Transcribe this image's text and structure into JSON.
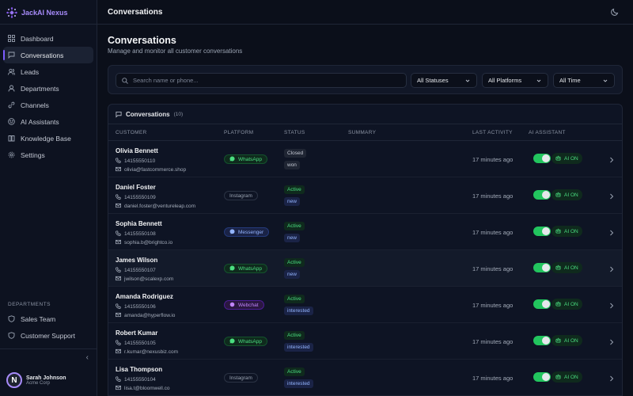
{
  "brand": {
    "name": "JackAI Nexus",
    "accent": "#a78bfa"
  },
  "sidebar": {
    "items": [
      {
        "label": "Dashboard",
        "icon": "grid-icon",
        "active": false
      },
      {
        "label": "Conversations",
        "icon": "chat-icon",
        "active": true
      },
      {
        "label": "Leads",
        "icon": "users-icon",
        "active": false
      },
      {
        "label": "Departments",
        "icon": "building-icon",
        "active": false
      },
      {
        "label": "Channels",
        "icon": "link-icon",
        "active": false
      },
      {
        "label": "AI Assistants",
        "icon": "bot-icon",
        "active": false
      },
      {
        "label": "Knowledge Base",
        "icon": "book-icon",
        "active": false
      },
      {
        "label": "Settings",
        "icon": "gear-icon",
        "active": false
      }
    ],
    "departments_title": "DEPARTMENTS",
    "departments": [
      {
        "label": "Sales Team",
        "icon": "shield-icon"
      },
      {
        "label": "Customer Support",
        "icon": "shield-icon"
      }
    ],
    "collapse_icon": "chevron-left-icon"
  },
  "user": {
    "initial": "N",
    "name": "Sarah Johnson",
    "org": "Acme Corp"
  },
  "topbar": {
    "title": "Conversations",
    "theme_icon": "moon-icon"
  },
  "page": {
    "title": "Conversations",
    "subtitle": "Manage and monitor all customer conversations"
  },
  "filters": {
    "search_placeholder": "Search name or phone...",
    "status": "All Statuses",
    "platform": "All Platforms",
    "time": "All Time"
  },
  "table": {
    "title": "Conversations",
    "count": "(10)",
    "headers": {
      "customer": "CUSTOMER",
      "platform": "PLATFORM",
      "status": "STATUS",
      "summary": "SUMMARY",
      "last_activity": "LAST ACTIVITY",
      "ai_assistant": "AI ASSISTANT"
    },
    "rows": [
      {
        "name": "Olivia Bennett",
        "phone": "14155550110",
        "email": "olivia@fastcommerce.shop",
        "platform": "WhatsApp",
        "platform_type": "wa",
        "status1": "Closed",
        "status1_type": "closed",
        "status2": "won",
        "status2_type": "won",
        "last": "17 minutes ago",
        "ai": "AI ON"
      },
      {
        "name": "Daniel Foster",
        "phone": "14155550109",
        "email": "daniel.foster@ventureleap.com",
        "platform": "Instagram",
        "platform_type": "ig",
        "status1": "Active",
        "status1_type": "active",
        "status2": "new",
        "status2_type": "new",
        "last": "17 minutes ago",
        "ai": "AI ON"
      },
      {
        "name": "Sophia Bennett",
        "phone": "14155550108",
        "email": "sophia.b@brightco.io",
        "platform": "Messenger",
        "platform_type": "ms",
        "status1": "Active",
        "status1_type": "active",
        "status2": "new",
        "status2_type": "new",
        "last": "17 minutes ago",
        "ai": "AI ON"
      },
      {
        "name": "James Wilson",
        "phone": "14155550107",
        "email": "jwilson@scalexp.com",
        "platform": "WhatsApp",
        "platform_type": "wa",
        "status1": "Active",
        "status1_type": "active",
        "status2": "new",
        "status2_type": "new",
        "last": "17 minutes ago",
        "ai": "AI ON"
      },
      {
        "name": "Amanda Rodriguez",
        "phone": "14155550106",
        "email": "amanda@hyperflow.io",
        "platform": "Webchat",
        "platform_type": "wc",
        "status1": "Active",
        "status1_type": "active",
        "status2": "interested",
        "status2_type": "interested",
        "last": "17 minutes ago",
        "ai": "AI ON"
      },
      {
        "name": "Robert Kumar",
        "phone": "14155550105",
        "email": "r.kumar@nexusbiz.com",
        "platform": "WhatsApp",
        "platform_type": "wa",
        "status1": "Active",
        "status1_type": "active",
        "status2": "interested",
        "status2_type": "interested",
        "last": "17 minutes ago",
        "ai": "AI ON"
      },
      {
        "name": "Lisa Thompson",
        "phone": "14155550104",
        "email": "lisa.t@bloomwell.co",
        "platform": "Instagram",
        "platform_type": "ig",
        "status1": "Active",
        "status1_type": "active",
        "status2": "interested",
        "status2_type": "interested",
        "last": "17 minutes ago",
        "ai": "AI ON"
      }
    ]
  }
}
